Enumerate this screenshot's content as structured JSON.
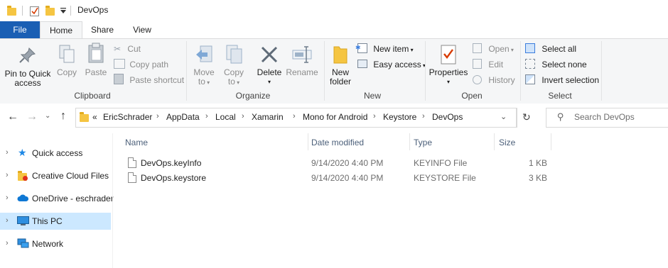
{
  "window": {
    "title": "DevOps"
  },
  "tabs": {
    "file": "File",
    "home": "Home",
    "share": "Share",
    "view": "View"
  },
  "ribbon": {
    "clipboard": {
      "label": "Clipboard",
      "pin": [
        "Pin to Quick",
        "access"
      ],
      "copy": "Copy",
      "paste": "Paste",
      "cut": "Cut",
      "copy_path": "Copy path",
      "paste_shortcut": "Paste shortcut"
    },
    "organize": {
      "label": "Organize",
      "move_to": [
        "Move",
        "to"
      ],
      "copy_to": [
        "Copy",
        "to"
      ],
      "delete": "Delete",
      "rename": "Rename"
    },
    "new": {
      "label": "New",
      "new_folder": [
        "New",
        "folder"
      ],
      "new_item": "New item",
      "easy_access": "Easy access"
    },
    "open": {
      "label": "Open",
      "properties": "Properties",
      "open": "Open",
      "edit": "Edit",
      "history": "History"
    },
    "select": {
      "label": "Select",
      "select_all": "Select all",
      "select_none": "Select none",
      "invert": "Invert selection"
    }
  },
  "address": {
    "overflow": "«",
    "crumbs": [
      "EricSchrader",
      "AppData",
      "Local",
      "Xamarin",
      "Mono for Android",
      "Keystore",
      "DevOps"
    ],
    "search_placeholder": "Search DevOps"
  },
  "nav": [
    {
      "label": "Quick access"
    },
    {
      "label": "Creative Cloud Files"
    },
    {
      "label": "OneDrive - eschrader"
    },
    {
      "label": "This PC",
      "selected": true
    },
    {
      "label": "Network"
    }
  ],
  "columns": [
    "Name",
    "Date modified",
    "Type",
    "Size"
  ],
  "files": [
    {
      "name": "DevOps.keyInfo",
      "date": "9/14/2020 4:40 PM",
      "type": "KEYINFO File",
      "size": "1 KB"
    },
    {
      "name": "DevOps.keystore",
      "date": "9/14/2020 4:40 PM",
      "type": "KEYSTORE File",
      "size": "3 KB"
    }
  ],
  "colors": {
    "accent": "#1a5fb4",
    "selected_bg": "#cce8ff",
    "folder": "#f5c542"
  }
}
